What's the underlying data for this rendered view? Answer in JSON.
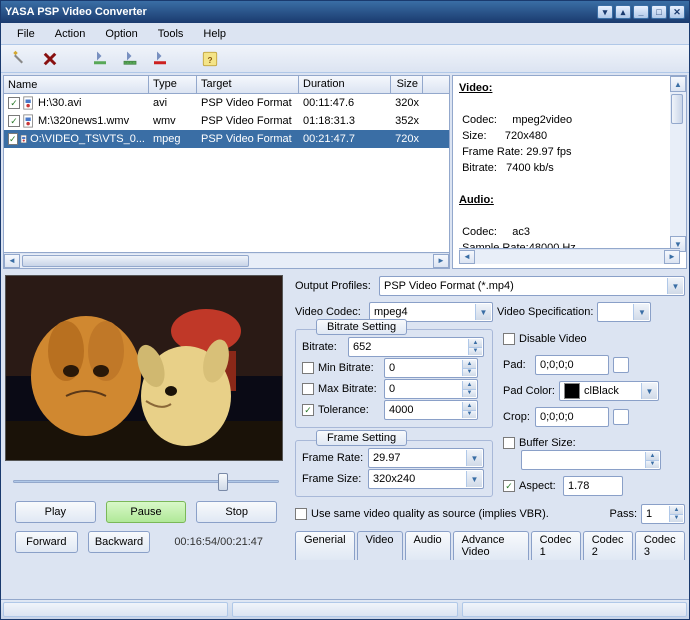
{
  "title": "YASA PSP Video Converter",
  "menu": [
    "File",
    "Action",
    "Option",
    "Tools",
    "Help"
  ],
  "columns": {
    "name": "Name",
    "type": "Type",
    "target": "Target",
    "duration": "Duration",
    "size": "Size"
  },
  "files": [
    {
      "name": "H:\\30.avi",
      "type": "avi",
      "target": "PSP Video Format",
      "duration": "00:11:47.6",
      "size": "320x"
    },
    {
      "name": "M:\\320news1.wmv",
      "type": "wmv",
      "target": "PSP Video Format",
      "duration": "01:18:31.3",
      "size": "352x"
    },
    {
      "name": "O:\\VIDEO_TS\\VTS_0...",
      "type": "mpeg",
      "target": "PSP Video Format",
      "duration": "00:21:47.7",
      "size": "720x"
    }
  ],
  "info": {
    "video_header": "Video:",
    "codec_label": "Codec:",
    "codec": "mpeg2video",
    "size_label": "Size:",
    "size": "720x480",
    "fr_label": "Frame Rate:",
    "fr": "29.97 fps",
    "br_label": "Bitrate:",
    "br": "7400 kb/s",
    "audio_header": "Audio:",
    "a_codec_label": "Codec:",
    "a_codec": "ac3",
    "sr_label": "Sample Rate:",
    "sr": "48000 Hz"
  },
  "output": {
    "profiles_label": "Output Profiles:",
    "profile": "PSP Video Format (*.mp4)",
    "codec_label": "Video Codec:",
    "codec": "mpeg4",
    "spec_label": "Video Specification:"
  },
  "bitrate": {
    "heading": "Bitrate Setting",
    "br_label": "Bitrate:",
    "br": "652",
    "min_label": "Min Bitrate:",
    "min": "0",
    "max_label": "Max Bitrate:",
    "max": "0",
    "tol_label": "Tolerance:",
    "tol": "4000"
  },
  "frame": {
    "heading": "Frame Setting",
    "rate_label": "Frame Rate:",
    "rate": "29.97",
    "size_label": "Frame Size:",
    "size": "320x240"
  },
  "right": {
    "disable": "Disable Video",
    "pad_label": "Pad:",
    "pad": "0;0;0;0",
    "padcolor_label": "Pad Color:",
    "padcolor": "clBlack",
    "crop_label": "Crop:",
    "crop": "0;0;0;0",
    "buffer_label": "Buffer Size:",
    "aspect_label": "Aspect:",
    "aspect": "1.78"
  },
  "bottom": {
    "vbr": "Use same video quality as source (implies VBR).",
    "pass_label": "Pass:",
    "pass": "1"
  },
  "buttons": {
    "play": "Play",
    "pause": "Pause",
    "stop": "Stop",
    "forward": "Forward",
    "backward": "Backward"
  },
  "time": "00:16:54/00:21:47",
  "tabs": [
    "Generial",
    "Video",
    "Audio",
    "Advance Video",
    "Codec 1",
    "Codec 2",
    "Codec 3"
  ]
}
